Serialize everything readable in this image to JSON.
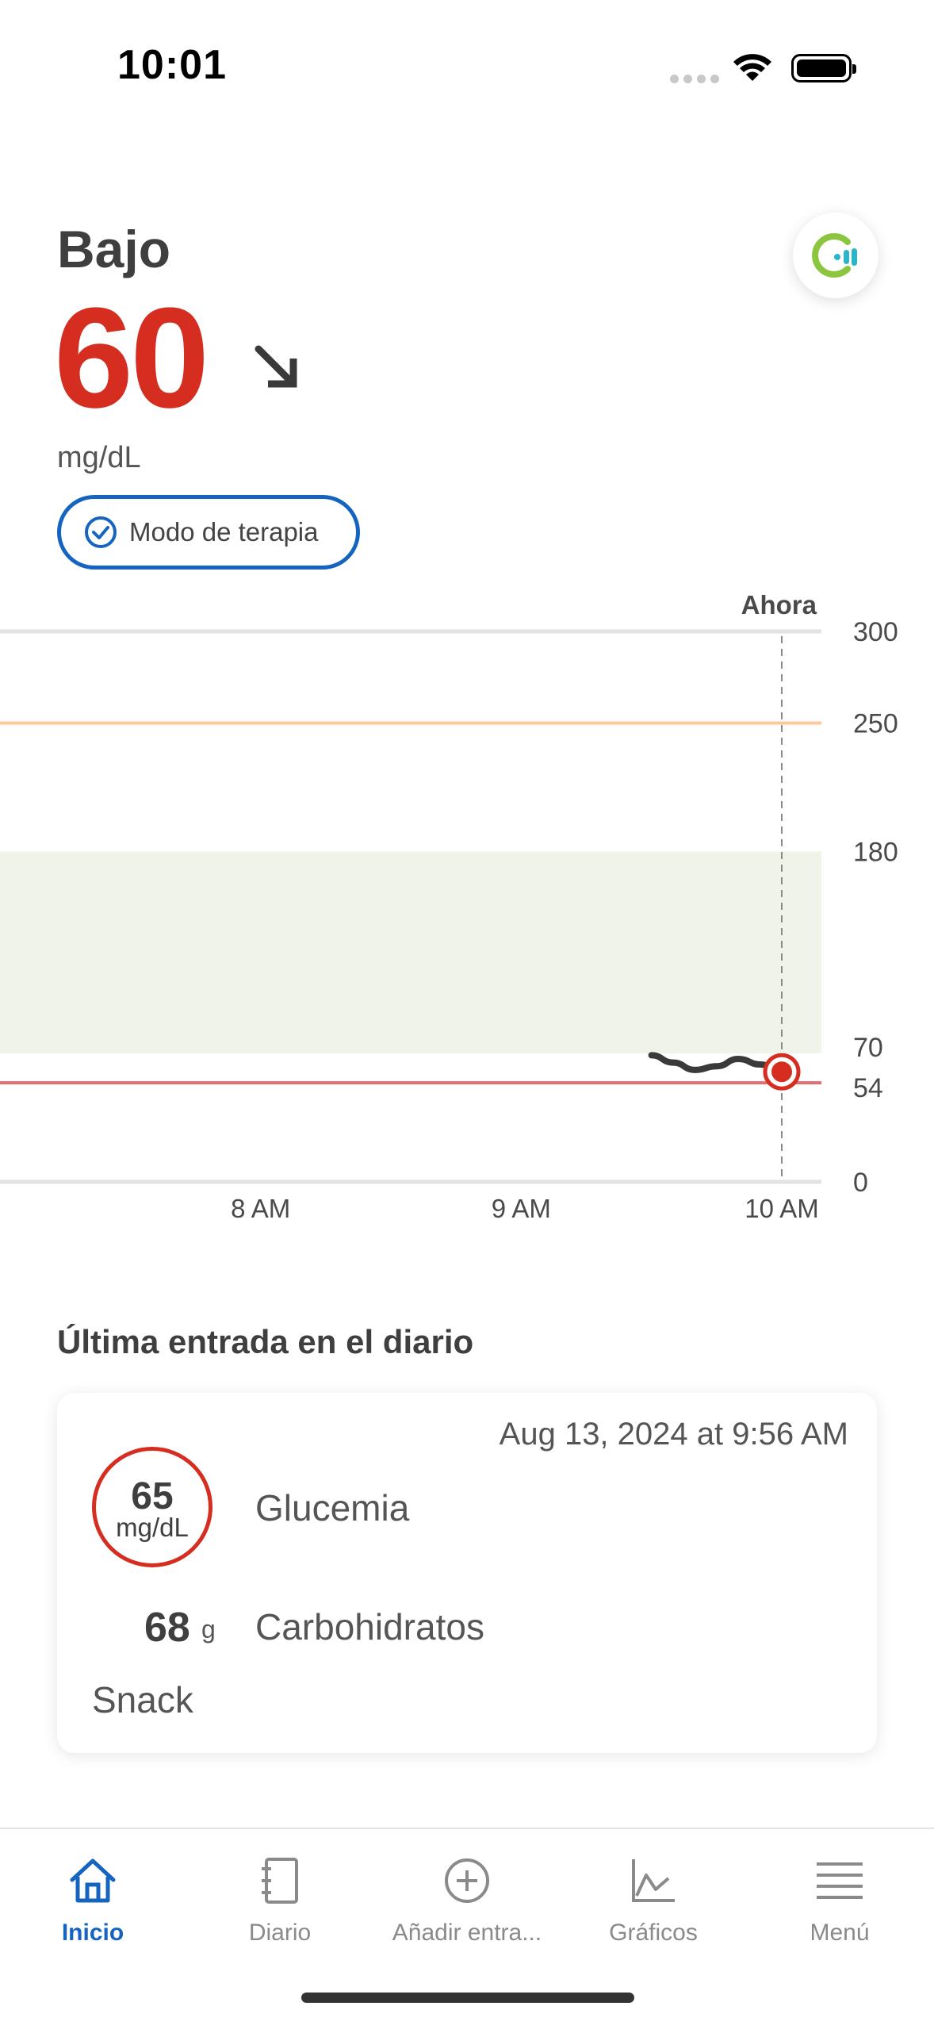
{
  "status_bar": {
    "time": "10:01"
  },
  "reading": {
    "status": "Bajo",
    "value": "60",
    "unit": "mg/dL",
    "trend_icon": "arrow-down-right-icon",
    "therapy_mode_label": "Modo de terapia",
    "app_icon": "app-logo-icon"
  },
  "colors": {
    "low": "#d52d1f",
    "accent": "#1565c0",
    "target_range": "#f0f4e8",
    "high_line": "#fcc99b",
    "low_line": "#e07070"
  },
  "chart_data": {
    "type": "line",
    "now_label": "Ahora",
    "x_ticks": [
      "8 AM",
      "9 AM",
      "10 AM"
    ],
    "y_ticks": [
      0,
      54,
      70,
      180,
      250,
      300
    ],
    "ylim": [
      0,
      300
    ],
    "target_range": [
      70,
      180
    ],
    "high_threshold": 250,
    "low_threshold": 54,
    "series": [
      {
        "x": [
          "9:30",
          "9:35",
          "9:40",
          "9:45",
          "9:50",
          "9:55",
          "10:00"
        ],
        "values": [
          69,
          65,
          61,
          63,
          67,
          64,
          60
        ]
      }
    ],
    "current_point": {
      "x": "10:00",
      "value": 60
    }
  },
  "journal": {
    "section_title": "Última entrada en el diario",
    "date": "Aug 13, 2024 at 9:56 AM",
    "glucose_value": "65",
    "glucose_unit": "mg/dL",
    "glucose_label": "Glucemia",
    "carbs_value": "68",
    "carbs_unit": "g",
    "carbs_label": "Carbohidratos",
    "meal": "Snack"
  },
  "tabs": [
    {
      "label": "Inicio",
      "icon": "home-icon",
      "active": true
    },
    {
      "label": "Diario",
      "icon": "logbook-icon",
      "active": false
    },
    {
      "label": "Añadir entra...",
      "icon": "add-circle-icon",
      "active": false
    },
    {
      "label": "Gráficos",
      "icon": "chart-icon",
      "active": false
    },
    {
      "label": "Menú",
      "icon": "menu-icon",
      "active": false
    }
  ]
}
